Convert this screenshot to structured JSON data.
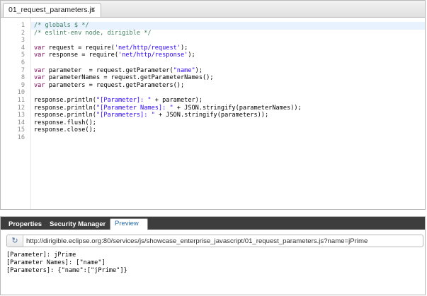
{
  "editor": {
    "tab_label": "01_request_parameters.js",
    "tab_close": "x",
    "line_numbers": [
      "1",
      "2",
      "3",
      "4",
      "5",
      "6",
      "7",
      "8",
      "9",
      "10",
      "11",
      "12",
      "13",
      "14",
      "15",
      "16"
    ],
    "lines": [
      {
        "parts": [
          {
            "t": "/* globals $ */",
            "c": "cm"
          }
        ]
      },
      {
        "parts": [
          {
            "t": "/* eslint-env node, dirigible */",
            "c": "cm"
          }
        ]
      },
      {
        "parts": []
      },
      {
        "parts": [
          {
            "t": "var",
            "c": "kw"
          },
          {
            "t": " request = require("
          },
          {
            "t": "'net/http/request'",
            "c": "str"
          },
          {
            "t": ");"
          }
        ]
      },
      {
        "parts": [
          {
            "t": "var",
            "c": "kw"
          },
          {
            "t": " response = require("
          },
          {
            "t": "'net/http/response'",
            "c": "str"
          },
          {
            "t": ");"
          }
        ]
      },
      {
        "parts": []
      },
      {
        "parts": [
          {
            "t": "var",
            "c": "kw"
          },
          {
            "t": " parameter  = request.getParameter("
          },
          {
            "t": "\"name\"",
            "c": "str"
          },
          {
            "t": ");"
          }
        ]
      },
      {
        "parts": [
          {
            "t": "var",
            "c": "kw"
          },
          {
            "t": " parameterNames = request.getParameterNames();"
          }
        ]
      },
      {
        "parts": [
          {
            "t": "var",
            "c": "kw"
          },
          {
            "t": " parameters = request.getParameters();"
          }
        ]
      },
      {
        "parts": []
      },
      {
        "parts": [
          {
            "t": "response.println("
          },
          {
            "t": "\"[Parameter]: \"",
            "c": "str"
          },
          {
            "t": " + parameter);"
          }
        ]
      },
      {
        "parts": [
          {
            "t": "response.println("
          },
          {
            "t": "\"[Parameter Names]: \"",
            "c": "str"
          },
          {
            "t": " + JSON.stringify(parameterNames));"
          }
        ]
      },
      {
        "parts": [
          {
            "t": "response.println("
          },
          {
            "t": "\"[Parameters]: \"",
            "c": "str"
          },
          {
            "t": " + JSON.stringify(parameters));"
          }
        ]
      },
      {
        "parts": [
          {
            "t": "response.flush();"
          }
        ]
      },
      {
        "parts": [
          {
            "t": "response.close();"
          }
        ]
      },
      {
        "parts": []
      }
    ]
  },
  "bottom_panel": {
    "tabs": [
      {
        "label": "Properties"
      },
      {
        "label": "Security Manager"
      },
      {
        "label": "Preview"
      }
    ],
    "refresh_icon": "refresh-icon",
    "url": "http://dirigible.eclipse.org:80/services/js/showcase_enterprise_javascript/01_request_parameters.js?name=jPrime",
    "output_lines": [
      "[Parameter]: jPrime",
      "[Parameter Names]: [\"name\"]",
      "[Parameters]: {\"name\":[\"jPrime\"]}"
    ]
  },
  "colors": {
    "keyword": "#7f0055",
    "string": "#2a00ff",
    "comment": "#3f7f5f",
    "active_line": "#e8f2fe",
    "panel_tabbar": "#3d3d3d"
  }
}
